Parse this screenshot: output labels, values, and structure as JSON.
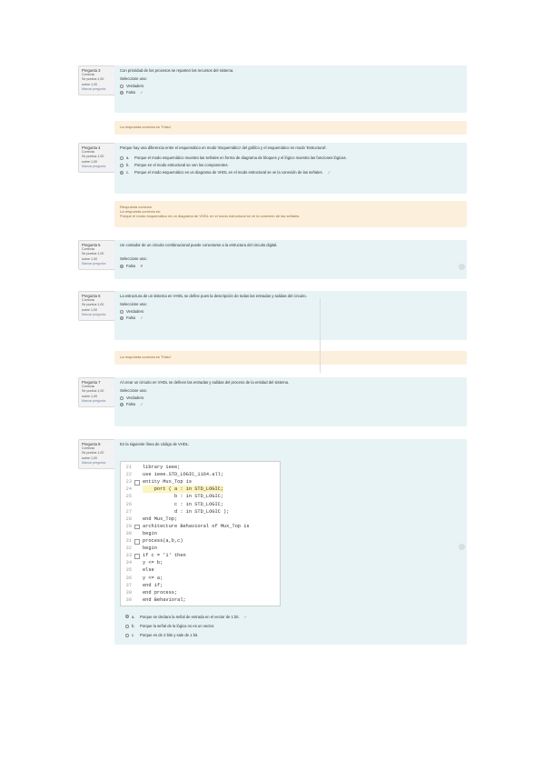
{
  "questions": [
    {
      "info": {
        "number": "Pregunta 3",
        "state": "Correcta",
        "marks": "Se puntúa 1,00 sobre 1,00",
        "flag": "Marcar pregunta"
      },
      "text": "Con prioridad de los procesos se reparten los recursos del sistema.",
      "select_label": "Seleccione una:",
      "options": [
        {
          "label": "Verdadero",
          "selected": false
        },
        {
          "label": "Falso",
          "selected": true,
          "mark": "✓"
        }
      ],
      "feedback": "La respuesta correcta es 'Falso'"
    },
    {
      "info": {
        "number": "Pregunta 4",
        "state": "Correcta",
        "marks": "Se puntúa 1,00 sobre 1,00",
        "flag": "Marcar pregunta"
      },
      "text": "Porque hay una diferencia entre el esquemático en modo 'Esquemático' del gráfico y el esquemático en modo 'Estructural'.",
      "options": [
        {
          "letter": "a.",
          "label": "Porque el modo esquemático muestra las señales en forma de diagrama de bloques y el lógico muestra las funciones lógicas.",
          "selected": false
        },
        {
          "letter": "b.",
          "label": "Porque en el modo estructural se ven los componentes.",
          "selected": false
        },
        {
          "letter": "c.",
          "label": "Porque el modo esquemático es un diagrama de VHDL en el modo estructural se ve la conexión de las señales.",
          "selected": true,
          "mark": "✓"
        }
      ],
      "feedback_title": "Respuesta correcta",
      "feedback": "La respuesta correcta es:",
      "feedback_extra": "Porque el modo esquemático es un diagrama de VHDL en el modo estructural se ve la conexión de las señales."
    },
    {
      "info": {
        "number": "Pregunta 5",
        "state": "Correcta",
        "marks": "Se puntúa 1,00 sobre 1,00",
        "flag": "Marcar pregunta"
      },
      "text": "Un contador de un circuito combinacional puede conectarse a la estructura del circuito digital.",
      "select_label": "Seleccione una:",
      "options": [
        {
          "label": "Verdadero",
          "selected": false
        },
        {
          "label": "Falso",
          "selected": true,
          "mark": "✗"
        }
      ]
    },
    {
      "info": {
        "number": "Pregunta 6",
        "state": "Correcta",
        "marks": "Se puntúa 1,00 sobre 1,00",
        "flag": "Marcar pregunta"
      },
      "text": "La estructura de un sistema en VHDL se define pues la descripción de todas las entradas y salidas del circuito.",
      "select_label": "Seleccione una:",
      "options": [
        {
          "label": "Verdadero",
          "selected": false
        },
        {
          "label": "Falso",
          "selected": true,
          "mark": "✓"
        }
      ],
      "feedback": "La respuesta correcta es 'Falso'"
    },
    {
      "info": {
        "number": "Pregunta 7",
        "state": "Correcta",
        "marks": "Se puntúa 1,00 sobre 1,00",
        "flag": "Marcar pregunta"
      },
      "text": "Al crear un circuito en VHDL se definen las entradas y salidas del proceso de la entidad del sistema.",
      "select_label": "Seleccione una:",
      "options": [
        {
          "label": "Verdadero",
          "selected": false
        },
        {
          "label": "Falso",
          "selected": true,
          "mark": "✓"
        }
      ]
    },
    {
      "info": {
        "number": "Pregunta 8",
        "state": "Correcta",
        "marks": "Se puntúa 1,00 sobre 1,00",
        "flag": "Marcar pregunta"
      },
      "text": "En la siguiente línea de código de VHDL:",
      "code": [
        {
          "n": "21",
          "t": "library ieee;"
        },
        {
          "n": "22",
          "t": "use ieee.STD_LOGIC_1164.all;"
        },
        {
          "n": "23",
          "t": "entity Mux_Top is"
        },
        {
          "n": "24",
          "t": "    port ( a : in STD_LOGIC;"
        },
        {
          "n": "25",
          "t": "           b : in STD_LOGIC;"
        },
        {
          "n": "26",
          "t": "           c : in STD_LOGIC;"
        },
        {
          "n": "27",
          "t": "           d : in STD_LOGIC );"
        },
        {
          "n": "28",
          "t": "end Mux_Top;"
        },
        {
          "n": "29",
          "t": "architecture Behavioral of Mux_Top is"
        },
        {
          "n": "30",
          "t": "begin"
        },
        {
          "n": "31",
          "t": "process(a,b,c)"
        },
        {
          "n": "32",
          "t": "begin"
        },
        {
          "n": "33",
          "t": "if c = '1' then"
        },
        {
          "n": "34",
          "t": "y <= b;"
        },
        {
          "n": "35",
          "t": "else"
        },
        {
          "n": "36",
          "t": "y <= a;"
        },
        {
          "n": "37",
          "t": "end if;"
        },
        {
          "n": "38",
          "t": "end process;"
        },
        {
          "n": "39",
          "t": "end Behavioral;"
        }
      ],
      "options": [
        {
          "letter": "a.",
          "label": "Porque se declara la señal de entrada en el vector de 1 bit.",
          "selected": true,
          "mark": "✓"
        },
        {
          "letter": "b.",
          "label": "Porque la señal de la lógica no es un vector.",
          "selected": false
        },
        {
          "letter": "c.",
          "label": "Porque es de 2 bits y sale de 1 bit.",
          "selected": false
        }
      ]
    }
  ]
}
